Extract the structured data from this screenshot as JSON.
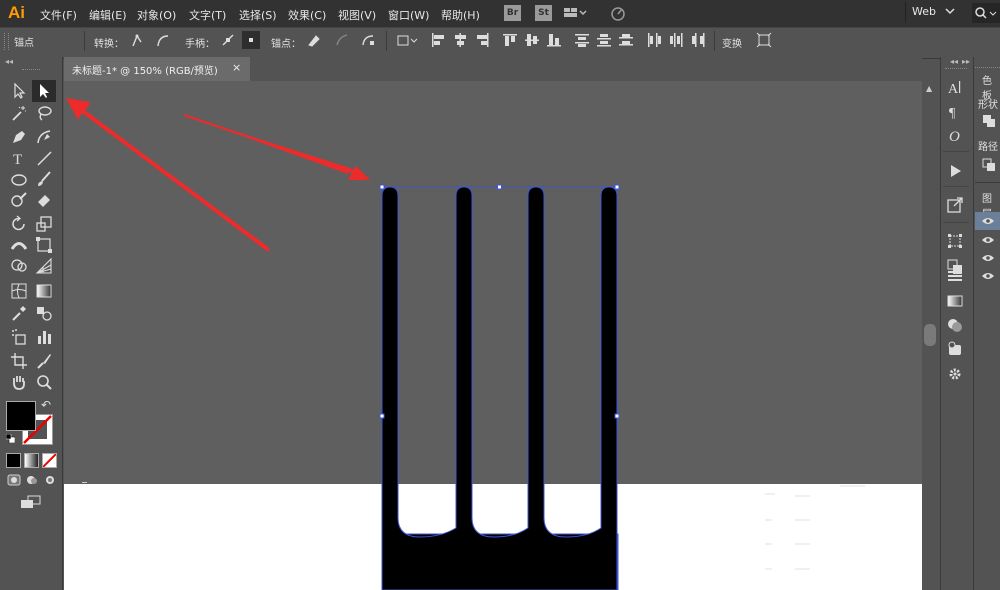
{
  "app": {
    "logo": "Ai"
  },
  "menu": {
    "items": [
      "文件(F)",
      "编辑(E)",
      "对象(O)",
      "文字(T)",
      "选择(S)",
      "效果(C)",
      "视图(V)",
      "窗口(W)",
      "帮助(H)"
    ],
    "bridge_btn": "Br",
    "stock_btn": "St",
    "workspace": "Web"
  },
  "control_bar": {
    "selection_label": "锚点",
    "convert_label": "转换：",
    "handles_label": "手柄：",
    "anchors_label": "锚点：",
    "transform_label": "变换"
  },
  "document": {
    "tab_title": "未标题-1* @ 150% (RGB/预览)",
    "close_symbol": "×"
  },
  "right_panel": {
    "labels": [
      "色板",
      "形状",
      "路径",
      "图层"
    ]
  },
  "swatches": {
    "fill": "#000000",
    "stroke": "none"
  },
  "colors": {
    "menu_bg": "#323232",
    "ui_bg": "#535353",
    "canvas_bg": "#5f5f5f",
    "artboard": "#ffffff",
    "selection": "#3d55d6",
    "arrow": "#ee2b2b",
    "logo": "#ff9a00"
  }
}
